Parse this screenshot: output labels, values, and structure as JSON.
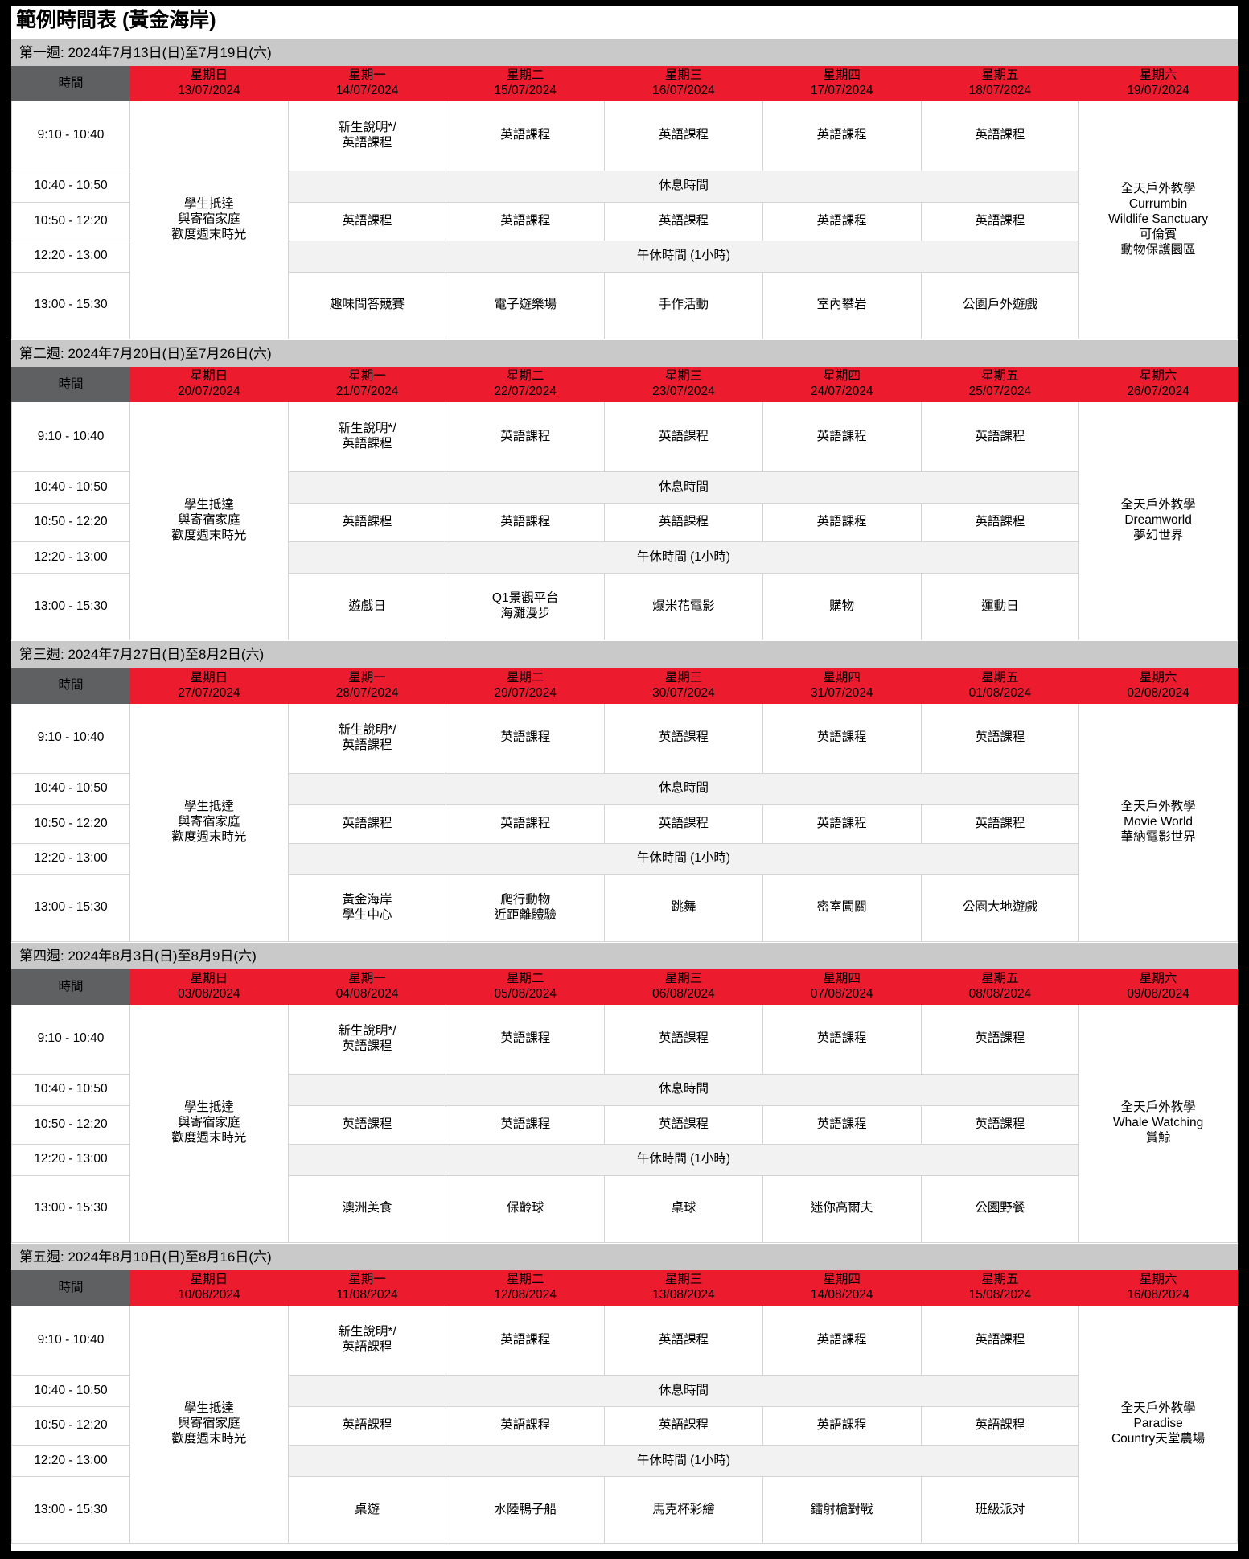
{
  "document": {
    "title": "範例時間表 (黃金海岸)",
    "colors": {
      "header_red": "#ec1c2e",
      "time_header_gray": "#5f6062",
      "week_band_gray": "#c9c9c9",
      "break_row_gray": "#f2f2f2",
      "page_border_black": "#000000"
    }
  },
  "labels": {
    "time_column": "時間",
    "break": "休息時間",
    "lunch": "午休時間 (1小時)",
    "lesson": "英語課程",
    "orientation": "新生說明*/\n英語課程",
    "sunday_note": "學生抵達\n與寄宿家庭\n歡度週末時光",
    "excursion_prefix": "全天戶外教學"
  },
  "time_slots": [
    "9:10 - 10:40",
    "10:40 - 10:50",
    "10:50 - 12:20",
    "12:20 - 13:00",
    "13:00 - 15:30"
  ],
  "weeks": [
    {
      "header": "第一週: 2024年7月13日(日)至7月19日(六)",
      "days": [
        {
          "dow": "星期日",
          "date": "13/07/2024"
        },
        {
          "dow": "星期一",
          "date": "14/07/2024"
        },
        {
          "dow": "星期二",
          "date": "15/07/2024"
        },
        {
          "dow": "星期三",
          "date": "16/07/2024"
        },
        {
          "dow": "星期四",
          "date": "17/07/2024"
        },
        {
          "dow": "星期五",
          "date": "18/07/2024"
        },
        {
          "dow": "星期六",
          "date": "19/07/2024"
        }
      ],
      "sunday": "學生抵達\n與寄宿家庭\n歡度週末時光",
      "morning1": [
        "新生說明*/\n英語課程",
        "英語課程",
        "英語課程",
        "英語課程",
        "英語課程"
      ],
      "morning2": [
        "英語課程",
        "英語課程",
        "英語課程",
        "英語課程",
        "英語課程"
      ],
      "afternoon": [
        "趣味問答競賽",
        "電子遊樂場",
        "手作活動",
        "室內攀岩",
        "公園戶外遊戲"
      ],
      "saturday": "全天戶外教學\nCurrumbin\nWildlife Sanctuary\n可倫賓\n動物保護園區"
    },
    {
      "header": "第二週: 2024年7月20日(日)至7月26日(六)",
      "days": [
        {
          "dow": "星期日",
          "date": "20/07/2024"
        },
        {
          "dow": "星期一",
          "date": "21/07/2024"
        },
        {
          "dow": "星期二",
          "date": "22/07/2024"
        },
        {
          "dow": "星期三",
          "date": "23/07/2024"
        },
        {
          "dow": "星期四",
          "date": "24/07/2024"
        },
        {
          "dow": "星期五",
          "date": "25/07/2024"
        },
        {
          "dow": "星期六",
          "date": "26/07/2024"
        }
      ],
      "sunday": "學生抵達\n與寄宿家庭\n歡度週末時光",
      "morning1": [
        "新生說明*/\n英語課程",
        "英語課程",
        "英語課程",
        "英語課程",
        "英語課程"
      ],
      "morning2": [
        "英語課程",
        "英語課程",
        "英語課程",
        "英語課程",
        "英語課程"
      ],
      "afternoon": [
        "遊戲日",
        "Q1景觀平台\n海灘漫步",
        "爆米花電影",
        "購物",
        "運動日"
      ],
      "saturday": "全天戶外教學\nDreamworld\n夢幻世界"
    },
    {
      "header": "第三週: 2024年7月27日(日)至8月2日(六)",
      "days": [
        {
          "dow": "星期日",
          "date": "27/07/2024"
        },
        {
          "dow": "星期一",
          "date": "28/07/2024"
        },
        {
          "dow": "星期二",
          "date": "29/07/2024"
        },
        {
          "dow": "星期三",
          "date": "30/07/2024"
        },
        {
          "dow": "星期四",
          "date": "31/07/2024"
        },
        {
          "dow": "星期五",
          "date": "01/08/2024"
        },
        {
          "dow": "星期六",
          "date": "02/08/2024"
        }
      ],
      "sunday": "學生抵達\n與寄宿家庭\n歡度週末時光",
      "morning1": [
        "新生說明*/\n英語課程",
        "英語課程",
        "英語課程",
        "英語課程",
        "英語課程"
      ],
      "morning2": [
        "英語課程",
        "英語課程",
        "英語課程",
        "英語課程",
        "英語課程"
      ],
      "afternoon": [
        "黃金海岸\n學生中心",
        "爬行動物\n近距離體驗",
        "跳舞",
        "密室闖關",
        "公園大地遊戲"
      ],
      "saturday": "全天戶外教學\nMovie World\n華納電影世界"
    },
    {
      "header": "第四週: 2024年8月3日(日)至8月9日(六)",
      "days": [
        {
          "dow": "星期日",
          "date": "03/08/2024"
        },
        {
          "dow": "星期一",
          "date": "04/08/2024"
        },
        {
          "dow": "星期二",
          "date": "05/08/2024"
        },
        {
          "dow": "星期三",
          "date": "06/08/2024"
        },
        {
          "dow": "星期四",
          "date": "07/08/2024"
        },
        {
          "dow": "星期五",
          "date": "08/08/2024"
        },
        {
          "dow": "星期六",
          "date": "09/08/2024"
        }
      ],
      "sunday": "學生抵達\n與寄宿家庭\n歡度週末時光",
      "morning1": [
        "新生說明*/\n英語課程",
        "英語課程",
        "英語課程",
        "英語課程",
        "英語課程"
      ],
      "morning2": [
        "英語課程",
        "英語課程",
        "英語課程",
        "英語課程",
        "英語課程"
      ],
      "afternoon": [
        "澳洲美食",
        "保齡球",
        "桌球",
        "迷你高爾夫",
        "公園野餐"
      ],
      "saturday": "全天戶外教學\nWhale Watching\n賞鯨"
    },
    {
      "header": "第五週: 2024年8月10日(日)至8月16日(六)",
      "days": [
        {
          "dow": "星期日",
          "date": "10/08/2024"
        },
        {
          "dow": "星期一",
          "date": "11/08/2024"
        },
        {
          "dow": "星期二",
          "date": "12/08/2024"
        },
        {
          "dow": "星期三",
          "date": "13/08/2024"
        },
        {
          "dow": "星期四",
          "date": "14/08/2024"
        },
        {
          "dow": "星期五",
          "date": "15/08/2024"
        },
        {
          "dow": "星期六",
          "date": "16/08/2024"
        }
      ],
      "sunday": "學生抵達\n與寄宿家庭\n歡度週末時光",
      "morning1": [
        "新生說明*/\n英語課程",
        "英語課程",
        "英語課程",
        "英語課程",
        "英語課程"
      ],
      "morning2": [
        "英語課程",
        "英語課程",
        "英語課程",
        "英語課程",
        "英語課程"
      ],
      "afternoon": [
        "桌遊",
        "水陸鴨子船",
        "馬克杯彩繪",
        "鐳射槍對戰",
        "班級派对"
      ],
      "saturday": "全天戶外教學\nParadise\nCountry天堂農場"
    }
  ]
}
